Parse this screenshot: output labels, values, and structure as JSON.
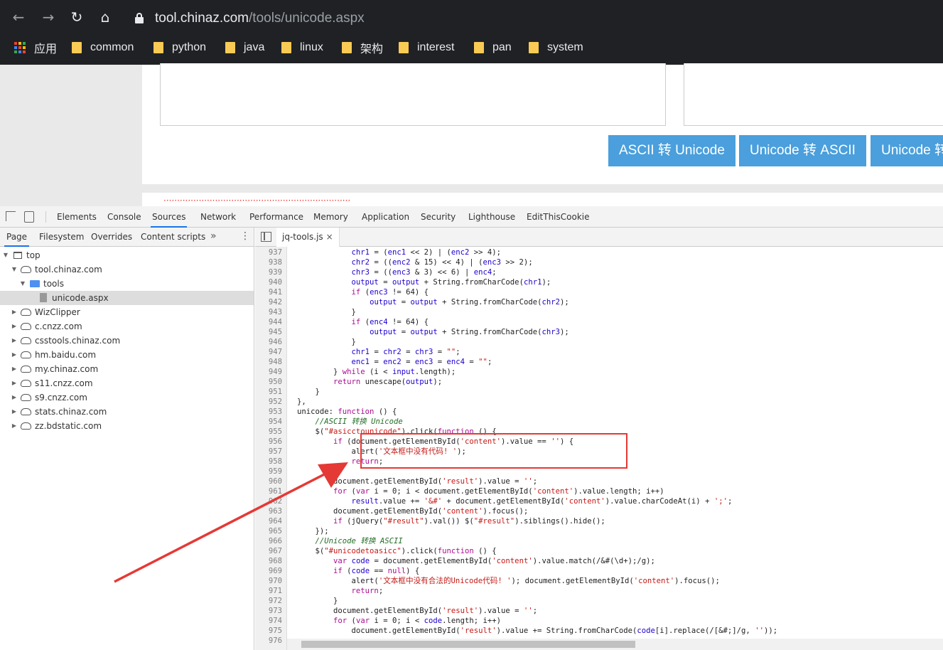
{
  "browser": {
    "url_host": "tool.chinaz.com",
    "url_path": "/tools/unicode.aspx",
    "bookmarks": [
      {
        "label": "应用",
        "icon": "apps-icon"
      },
      {
        "label": "common",
        "icon": "folder-icon"
      },
      {
        "label": "python",
        "icon": "folder-icon"
      },
      {
        "label": "java",
        "icon": "folder-icon"
      },
      {
        "label": "linux",
        "icon": "folder-icon"
      },
      {
        "label": "架构",
        "icon": "folder-icon"
      },
      {
        "label": "interest",
        "icon": "folder-icon"
      },
      {
        "label": "pan",
        "icon": "folder-icon"
      },
      {
        "label": "system",
        "icon": "folder-icon"
      }
    ]
  },
  "page": {
    "buttons": [
      "ASCII 转 Unicode",
      "Unicode 转 ASCII",
      "Unicode 转"
    ],
    "strip_text": "·····································································"
  },
  "devtools": {
    "tabs": [
      "Elements",
      "Console",
      "Sources",
      "Network",
      "Performance",
      "Memory",
      "Application",
      "Security",
      "Lighthouse",
      "EditThisCookie"
    ],
    "active_tab": "Sources",
    "nav_tabs": [
      "Page",
      "Filesystem",
      "Overrides",
      "Content scripts"
    ],
    "nav_more": "»",
    "tree": [
      {
        "label": "top",
        "icon": "frame-icon",
        "expanded": true
      },
      {
        "label": "tool.chinaz.com",
        "icon": "cloud-icon",
        "expanded": true
      },
      {
        "label": "tools",
        "icon": "folder-icon",
        "expanded": true
      },
      {
        "label": "unicode.aspx",
        "icon": "file-icon",
        "selected": true
      },
      {
        "label": "WizClipper",
        "icon": "cloud-icon"
      },
      {
        "label": "c.cnzz.com",
        "icon": "cloud-icon"
      },
      {
        "label": "csstools.chinaz.com",
        "icon": "cloud-icon"
      },
      {
        "label": "hm.baidu.com",
        "icon": "cloud-icon"
      },
      {
        "label": "my.chinaz.com",
        "icon": "cloud-icon"
      },
      {
        "label": "s11.cnzz.com",
        "icon": "cloud-icon"
      },
      {
        "label": "s9.cnzz.com",
        "icon": "cloud-icon"
      },
      {
        "label": "stats.chinaz.com",
        "icon": "cloud-icon"
      },
      {
        "label": "zz.bdstatic.com",
        "icon": "cloud-icon"
      }
    ],
    "file_tab": "jq-tools.js",
    "file_tab_close": "×",
    "code_lines": [
      {
        "n": "937",
        "t": "            chr1 = (enc1 << 2) | (enc2 >> 4);"
      },
      {
        "n": "938",
        "t": "            chr2 = ((enc2 & 15) << 4) | (enc3 >> 2);"
      },
      {
        "n": "939",
        "t": "            chr3 = ((enc3 & 3) << 6) | enc4;"
      },
      {
        "n": "940",
        "t": "            output = output + String.fromCharCode(chr1);"
      },
      {
        "n": "941",
        "t": "            if (enc3 != 64) {"
      },
      {
        "n": "942",
        "t": "                output = output + String.fromCharCode(chr2);"
      },
      {
        "n": "943",
        "t": "            }"
      },
      {
        "n": "944",
        "t": "            if (enc4 != 64) {"
      },
      {
        "n": "945",
        "t": "                output = output + String.fromCharCode(chr3);"
      },
      {
        "n": "946",
        "t": "            }"
      },
      {
        "n": "947",
        "t": "            chr1 = chr2 = chr3 = \"\";"
      },
      {
        "n": "948",
        "t": "            enc1 = enc2 = enc3 = enc4 = \"\";"
      },
      {
        "n": "949",
        "t": "        } while (i < input.length);"
      },
      {
        "n": "950",
        "t": "        return unescape(output);"
      },
      {
        "n": "951",
        "t": "    }"
      },
      {
        "n": "952",
        "t": "},"
      },
      {
        "n": "953",
        "t": "unicode: function () {"
      },
      {
        "n": "954",
        "t": "    //ASCII 转换 Unicode"
      },
      {
        "n": "955",
        "t": "    $(\"#asicctounicode\").click(function () {"
      },
      {
        "n": "956",
        "t": "        if (document.getElementById('content').value == '') {"
      },
      {
        "n": "957",
        "t": "            alert('文本框中没有代码! ');"
      },
      {
        "n": "958",
        "t": "            return;"
      },
      {
        "n": "959",
        "t": "        }"
      },
      {
        "n": "960",
        "t": "        document.getElementById('result').value = '';"
      },
      {
        "n": "961",
        "t": "        for (var i = 0; i < document.getElementById('content').value.length; i++)"
      },
      {
        "n": "962",
        "t": "            result.value += '&#' + document.getElementById('content').value.charCodeAt(i) + ';';"
      },
      {
        "n": "963",
        "t": "        document.getElementById('content').focus();"
      },
      {
        "n": "964",
        "t": "        if (jQuery(\"#result\").val()) $(\"#result\").siblings().hide();"
      },
      {
        "n": "965",
        "t": "    });"
      },
      {
        "n": "966",
        "t": "    //Unicode 转换 ASCII"
      },
      {
        "n": "967",
        "t": "    $(\"#unicodetoasicc\").click(function () {"
      },
      {
        "n": "968",
        "t": "        var code = document.getElementById('content').value.match(/&#(\\d+);/g);"
      },
      {
        "n": "969",
        "t": "        if (code == null) {"
      },
      {
        "n": "970",
        "t": "            alert('文本框中没有合法的Unicode代码! '); document.getElementById('content').focus();"
      },
      {
        "n": "971",
        "t": "            return;"
      },
      {
        "n": "972",
        "t": "        }"
      },
      {
        "n": "973",
        "t": "        document.getElementById('result').value = '';"
      },
      {
        "n": "974",
        "t": "        for (var i = 0; i < code.length; i++)"
      },
      {
        "n": "975",
        "t": "            document.getElementById('result').value += String.fromCharCode(code[i].replace(/[&#;]/g, ''));"
      },
      {
        "n": "976",
        "t": ""
      }
    ]
  },
  "colors": {
    "chrome_bg": "#202124",
    "page_button": "#4a9fdc",
    "highlight": "#e53935",
    "devtools_accent": "#1a73e8"
  }
}
